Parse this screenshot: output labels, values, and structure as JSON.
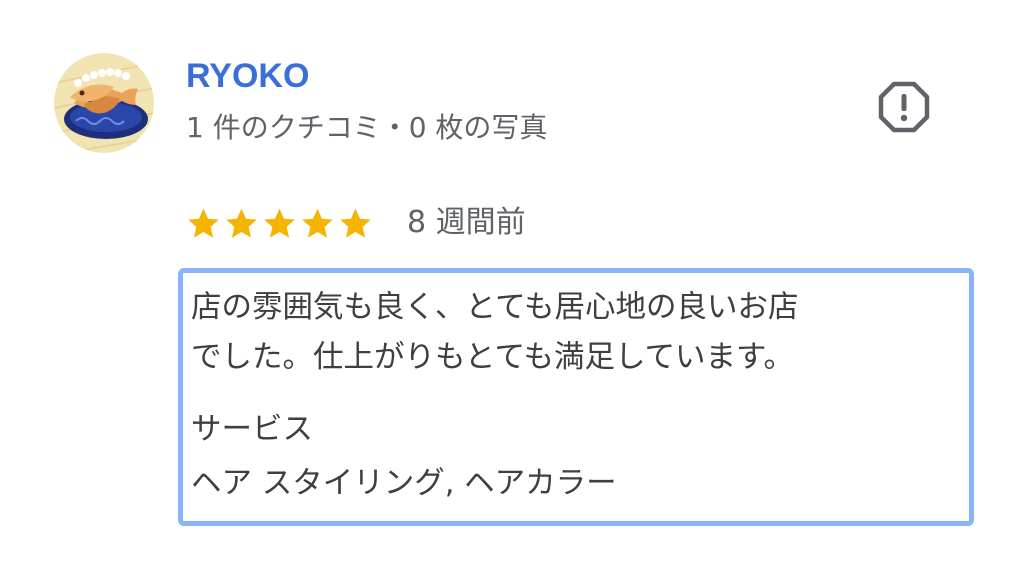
{
  "author": {
    "name": "RYOKO",
    "meta": "1 件のクチコミ・0 枚の写真",
    "avatar_icon": "taiyaki-avatar-icon"
  },
  "report_icon": "flag-report-icon",
  "rating": {
    "stars": 5,
    "max_stars": 5,
    "star_color": "#f4b400",
    "date": "8 週間前"
  },
  "review": {
    "lines": [
      "店の雰囲気も良く、とても居心地の良いお店",
      "でした。仕上がりもとても満足しています。"
    ],
    "services_label": "サービス",
    "services_value": "ヘア スタイリング, ヘアカラー",
    "highlight_color": "#8ab4f8"
  },
  "colors": {
    "name": "#3a6fd8",
    "meta": "#5f6368",
    "text": "#3c4043"
  }
}
